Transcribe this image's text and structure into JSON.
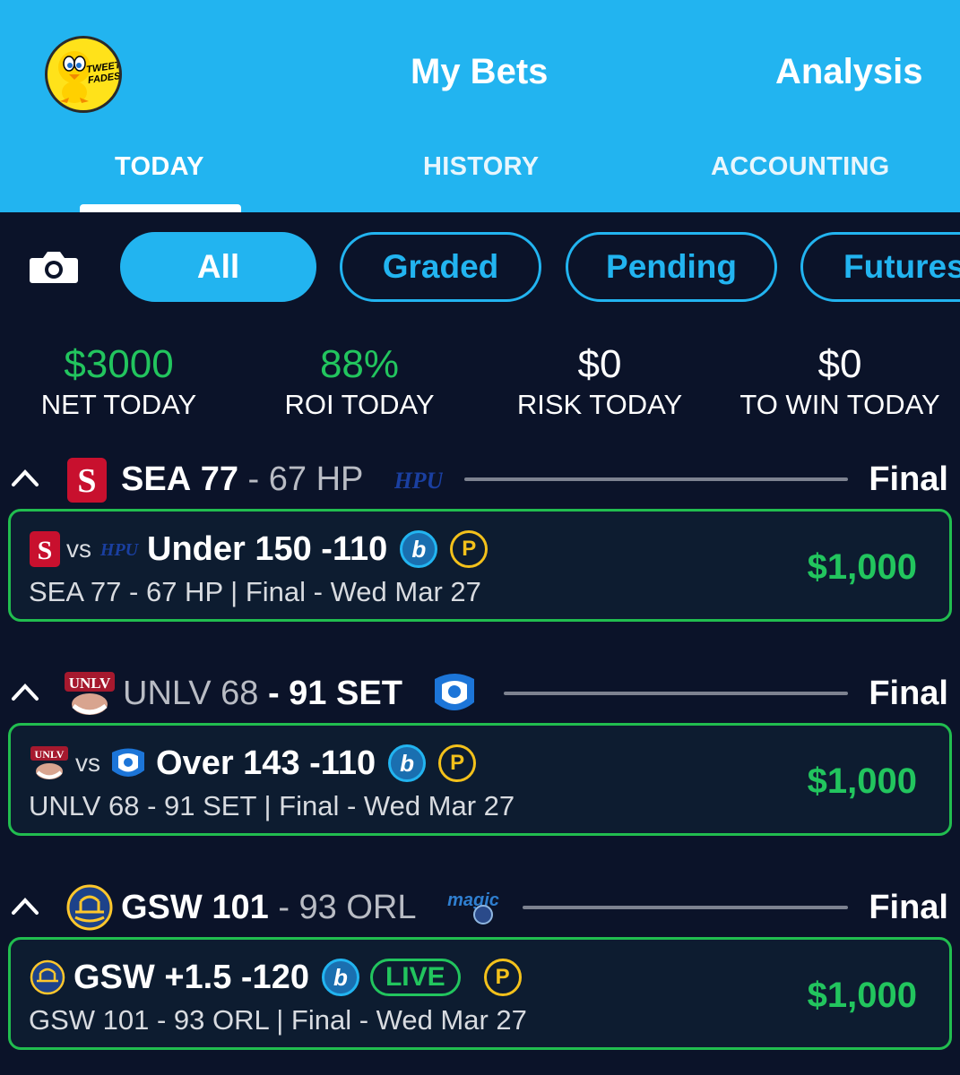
{
  "header": {
    "avatar_text": "TWEETY FADES",
    "title": "My Bets",
    "analysis": "Analysis",
    "tabs": [
      {
        "label": "TODAY",
        "active": true
      },
      {
        "label": "HISTORY",
        "active": false
      },
      {
        "label": "ACCOUNTING",
        "active": false
      }
    ]
  },
  "filters": [
    {
      "label": "All",
      "active": true
    },
    {
      "label": "Graded",
      "active": false
    },
    {
      "label": "Pending",
      "active": false
    },
    {
      "label": "Futures",
      "active": false
    }
  ],
  "stats": [
    {
      "value": "$3000",
      "label": "NET TODAY"
    },
    {
      "value": "88%",
      "label": "ROI TODAY"
    },
    {
      "value": "$0",
      "label": "RISK TODAY"
    },
    {
      "value": "$0",
      "label": "TO WIN TODAY"
    }
  ],
  "games": [
    {
      "team1": "SEA",
      "score1": "77",
      "sep": "-",
      "score2": "67",
      "team2": "HP",
      "status": "Final",
      "bet": {
        "vs": "vs",
        "title": "Under 150 -110",
        "sub": "SEA 77 - 67 HP | Final  - Wed Mar 27",
        "amount": "$1,000"
      }
    },
    {
      "team1": "UNLV",
      "score1": "68",
      "sep": "-",
      "score2": "91",
      "team2": "SET",
      "status": "Final",
      "bet": {
        "vs": "vs",
        "title": "Over 143 -110",
        "sub": "UNLV 68 - 91 SET | Final  - Wed Mar 27",
        "amount": "$1,000"
      }
    },
    {
      "team1": "GSW",
      "score1": "101",
      "sep": "-",
      "score2": "93",
      "team2": "ORL",
      "status": "Final",
      "bet": {
        "title": "GSW +1.5 -120",
        "live": "LIVE",
        "sub": "GSW 101 - 93 ORL | Final  - Wed Mar 27",
        "amount": "$1,000"
      }
    }
  ],
  "badges": {
    "b": "b",
    "p": "P"
  },
  "colors": {
    "header": "#22b4f0",
    "background": "#0b1329",
    "win": "#22c55e",
    "card_border": "#21bd4f",
    "p_badge": "#f3c11b"
  }
}
